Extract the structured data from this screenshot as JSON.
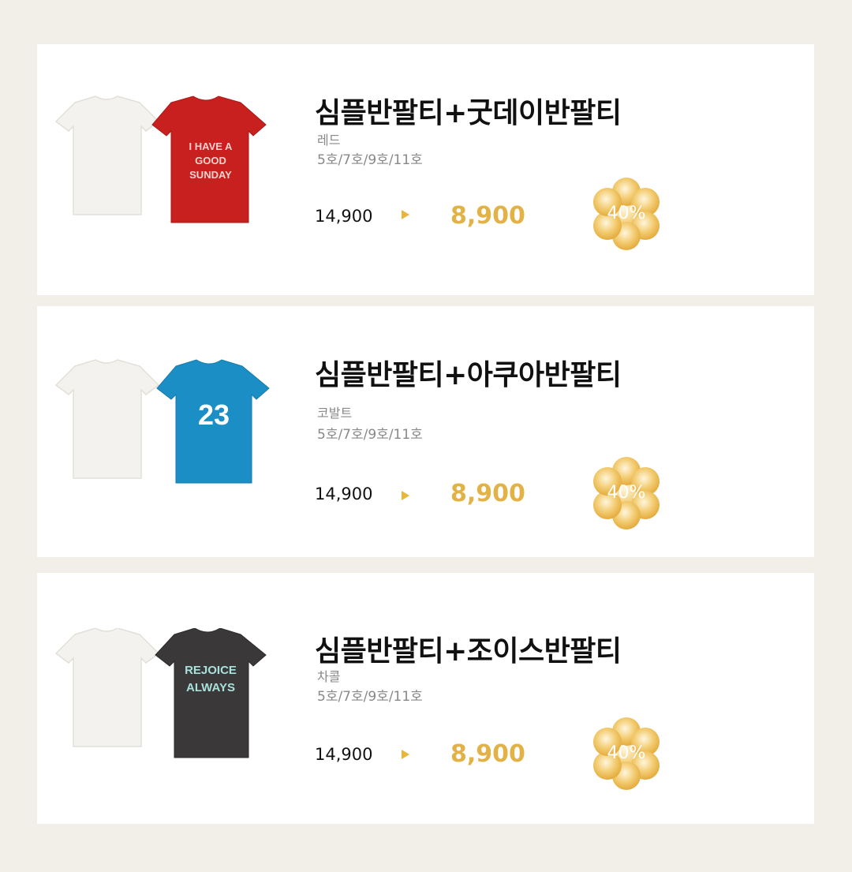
{
  "products": [
    {
      "title": "심플반팔티+굿데이반팔티",
      "color": "레드",
      "sizes": "5호/7호/9호/11호",
      "original_price": "14,900",
      "sale_price": "8,900",
      "discount": "40%",
      "shirt_color": "#c8201e",
      "print_lines": [
        "I HAVE A",
        "GOOD",
        "SUNDAY"
      ],
      "print_color": "#f4d3cf"
    },
    {
      "title": "심플반팔티+아쿠아반팔티",
      "color": "코발트",
      "sizes": "5호/7호/9호/11호",
      "original_price": "14,900",
      "sale_price": "8,900",
      "discount": "40%",
      "shirt_color": "#1b8ec6",
      "print_lines": [
        "23"
      ],
      "print_color": "#ffffff"
    },
    {
      "title": "심플반팔티+조이스반팔티",
      "color": "차콜",
      "sizes": "5호/7호/9호/11호",
      "original_price": "14,900",
      "sale_price": "8,900",
      "discount": "40%",
      "shirt_color": "#3a3838",
      "print_lines": [
        "REJOICE",
        "ALWAYS"
      ],
      "print_color": "#a9e0dc"
    }
  ],
  "colors": {
    "page_background": "#f1efe7",
    "card_background": "#ffffff",
    "accent": "#e3b247",
    "white_shirt": "#f4f2ee"
  }
}
